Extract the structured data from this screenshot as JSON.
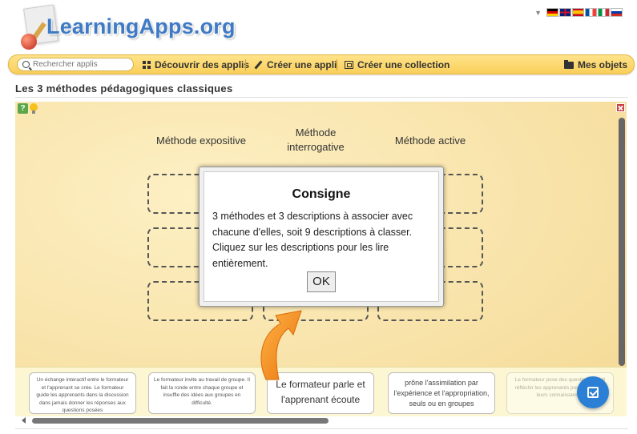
{
  "header": {
    "logo_text": "LearningApps.org",
    "flags": [
      "de",
      "gb",
      "es",
      "fr",
      "it",
      "ru"
    ]
  },
  "nav": {
    "search_placeholder": "Rechercher applis",
    "discover": "Découvrir des applis",
    "create_app": "Créer une appli",
    "create_collection": "Créer une collection",
    "my_objects": "Mes objets"
  },
  "page_title": "Les 3 méthodes pédagogiques classiques",
  "app": {
    "columns": [
      "Méthode expositive",
      "Méthode interrogative",
      "Méthode active"
    ],
    "cards": [
      "Un échange interactif entre le formateur et l'apprenant se crée. Le formateur guide les apprenants dans la discussion dans jamais donner les réponses aux questions posées",
      "Le formateur invite au travail de groupe. Il fait la ronde entre chaque groupe et insuffle des idées aux groupes en difficulté.",
      "Le formateur parle et l'apprenant écoute",
      "prône l'assimilation par l'expérience et l'appropriation, seuls ou en groupes",
      "Le formateur pose des questions et fait réfléchir les apprenants pour construire leurs connaissances"
    ]
  },
  "dialog": {
    "title": "Consigne",
    "text": "3 méthodes et 3 descriptions à associer avec chacune d'elles, soit 9 descriptions à classer. Cliquez sur les descriptions pour les lire entièrement.",
    "ok": "OK"
  },
  "colors": {
    "logo": "#3f7bc5",
    "navbar": "#f9cf5a",
    "app_bg": "#f7e0a3",
    "check_button": "#2b7fd4",
    "arrow": "#f28a1e"
  }
}
